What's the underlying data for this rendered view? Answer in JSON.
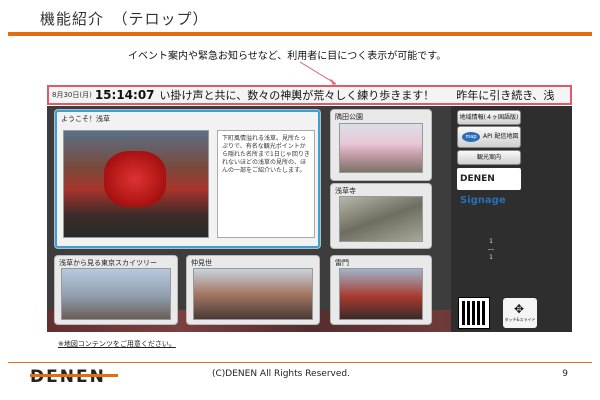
{
  "header": {
    "title": "機能紹介　（テロップ）"
  },
  "callout": {
    "text": "イベント案内や緊急お知らせなど、利用者に目につく表示が可能です。"
  },
  "ticker": {
    "date": "8月30日(月)",
    "time": "15:14:07",
    "message": "い掛け声と共に、数々の神輿が荒々しく練り歩きます！　　昨年に引き続き、浅"
  },
  "panels": {
    "welcome": {
      "label": "ようこそ！浅草",
      "description": "下町風情溢れる浅草。見所たっぷりで、有名な観光ポイントから隠れた名所まで1日じゃ回りきれないほどの浅草の見所の、ほんの一部をご紹介いたします。"
    },
    "sumida": {
      "label": "隅田公園"
    },
    "sensoji": {
      "label": "浅草寺"
    },
    "skytree": {
      "label": "浅草から見る東京スカイツリー"
    },
    "nakamise": {
      "label": "仲見世"
    },
    "kaminarimon": {
      "label": "雷門"
    }
  },
  "menu": {
    "area_info": "地域情報(４ヶ国語版)",
    "map_logo": "map",
    "map_api": "API",
    "delivery": "配信地図",
    "tourism": "観光案内",
    "brand_main": "DENEN",
    "brand_signage": "Signage",
    "page_current": "1",
    "page_total": "1",
    "touch_slide": "タッチ&スライド"
  },
  "note": "※地図コンテンツをご用意ください。",
  "footer": {
    "logo": "DENEN",
    "copyright": "(C)DENEN All Rights Reserved.",
    "page": "9"
  },
  "colors": {
    "accent": "#e46c0a",
    "highlight": "#e05a6a",
    "panel_border": "#3aa0d8"
  }
}
